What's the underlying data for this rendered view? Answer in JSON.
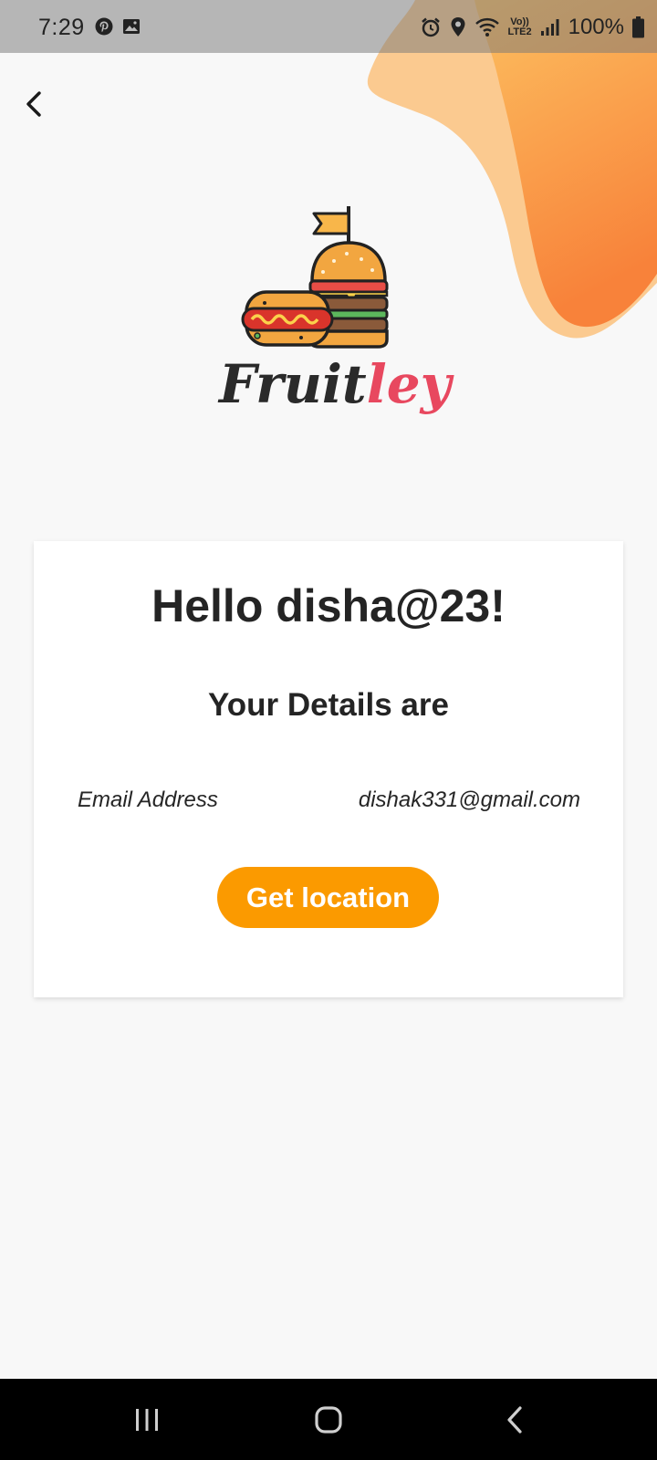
{
  "status_bar": {
    "time": "7:29",
    "battery": "100%",
    "left_icons": [
      "pinterest-icon",
      "image-icon"
    ],
    "right_icons": [
      "alarm-icon",
      "location-icon",
      "wifi-icon",
      "volte-icon",
      "signal-icon",
      "battery-icon"
    ],
    "volte_text": "Vo))",
    "lte_text": "LTE2"
  },
  "colors": {
    "accent": "#fb9a00",
    "blob_light": "#fbc97a",
    "blob_dark": "#f88735",
    "brand_dark": "#2a2a2a",
    "brand_pink": "#e8485f"
  },
  "header": {
    "back_icon": "back-arrow-icon"
  },
  "logo": {
    "icon": "burger-hotdog-flag-icon",
    "brand_part1": "Fruit",
    "brand_part2": "ley"
  },
  "card": {
    "greeting": "Hello disha@23!",
    "subheading": "Your Details are",
    "field_label": "Email Address",
    "field_value": "dishak331@gmail.com",
    "button_label": "Get location"
  },
  "nav_bar": {
    "items": [
      "recent-apps-icon",
      "home-icon",
      "back-icon"
    ]
  }
}
